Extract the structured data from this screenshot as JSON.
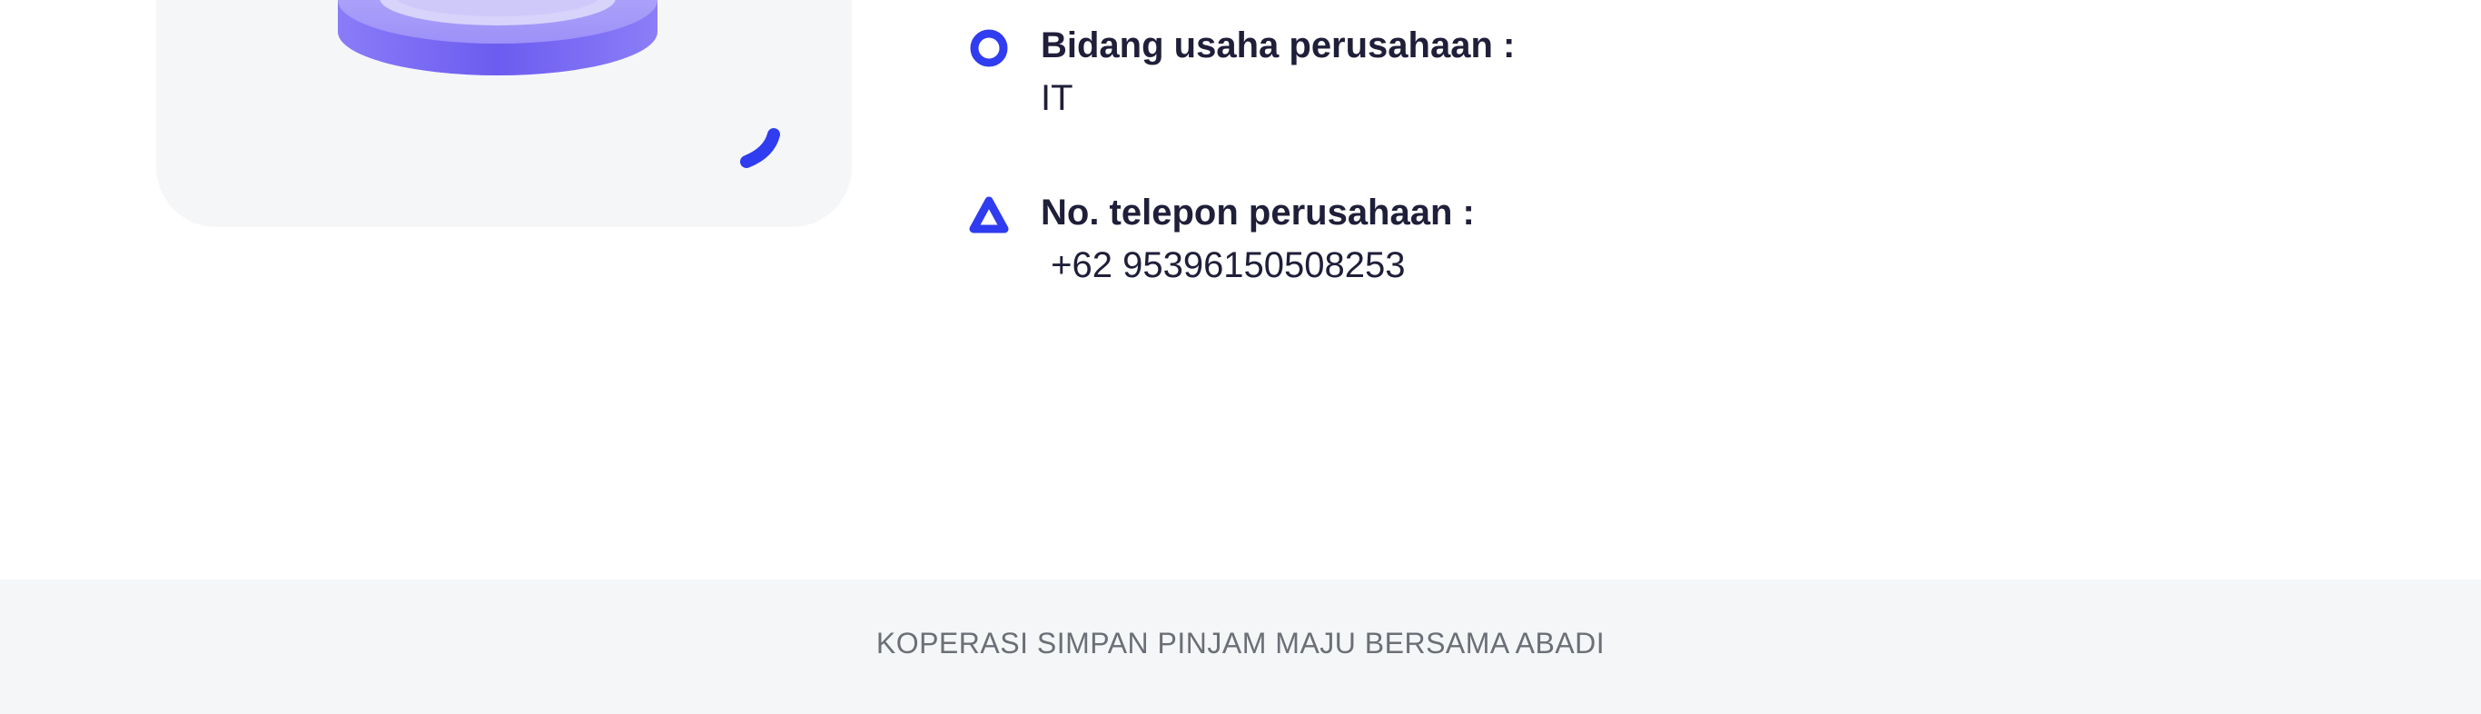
{
  "company_info": {
    "business_field": {
      "label": "Bidang usaha perusahaan :",
      "value": "IT",
      "icon": "circle-icon"
    },
    "phone": {
      "label": "No. telepon perusahaan :",
      "value": " +62 95396150508253",
      "icon": "triangle-icon"
    }
  },
  "footer": {
    "text": "KOPERASI SIMPAN PINJAM MAJU BERSAMA ABADI"
  },
  "colors": {
    "accent": "#2f3cf0",
    "illustration": "#7b6cf6",
    "text": "#1f1f3a",
    "footer_bg": "#f5f6f8",
    "footer_text": "#6b6f76"
  }
}
